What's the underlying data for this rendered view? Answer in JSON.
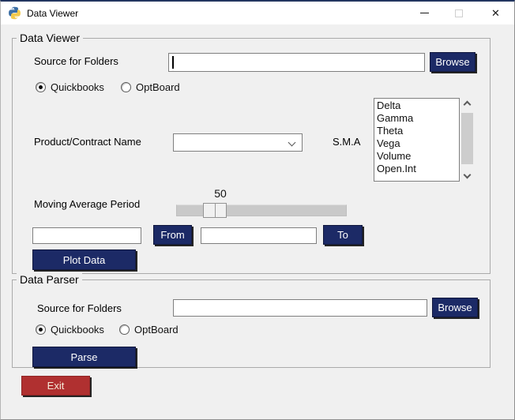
{
  "window": {
    "title": "Data Viewer",
    "icons": {
      "app": "python-logo",
      "minimize": "minimize-line",
      "maximize": "maximize-square",
      "close_glyph": "✕"
    }
  },
  "viewer": {
    "title": "Data Viewer",
    "source_label": "Source for Folders",
    "source_value": "",
    "browse_label": "Browse",
    "radios": [
      {
        "label": "Quickbooks",
        "selected": true
      },
      {
        "label": "OptBoard",
        "selected": false
      }
    ],
    "product_label": "Product/Contract Name",
    "product_value": "",
    "sma_label": "S.M.A",
    "listbox": {
      "items": [
        "Delta",
        "Gamma",
        "Theta",
        "Vega",
        "Volume",
        "Open.Int"
      ]
    },
    "moving_average_label": "Moving Average Period",
    "slider": {
      "value": "50"
    },
    "from_value": "",
    "from_label": "From",
    "to_value": "",
    "to_label": "To",
    "plot_label": "Plot Data"
  },
  "parser": {
    "title": "Data Parser",
    "source_label": "Source for Folders",
    "source_value": "",
    "browse_label": "Browse",
    "radios": [
      {
        "label": "Quickbooks",
        "selected": true
      },
      {
        "label": "OptBoard",
        "selected": false
      }
    ],
    "parse_label": "Parse"
  },
  "exit_label": "Exit",
  "colors": {
    "accent_navy": "#1c2a66",
    "exit_red": "#b03030",
    "window_bg": "#f0f0f0",
    "titlebar_bg": "#ffffff",
    "python_blue": "#3b6ea5",
    "python_yellow": "#f2c94c"
  }
}
